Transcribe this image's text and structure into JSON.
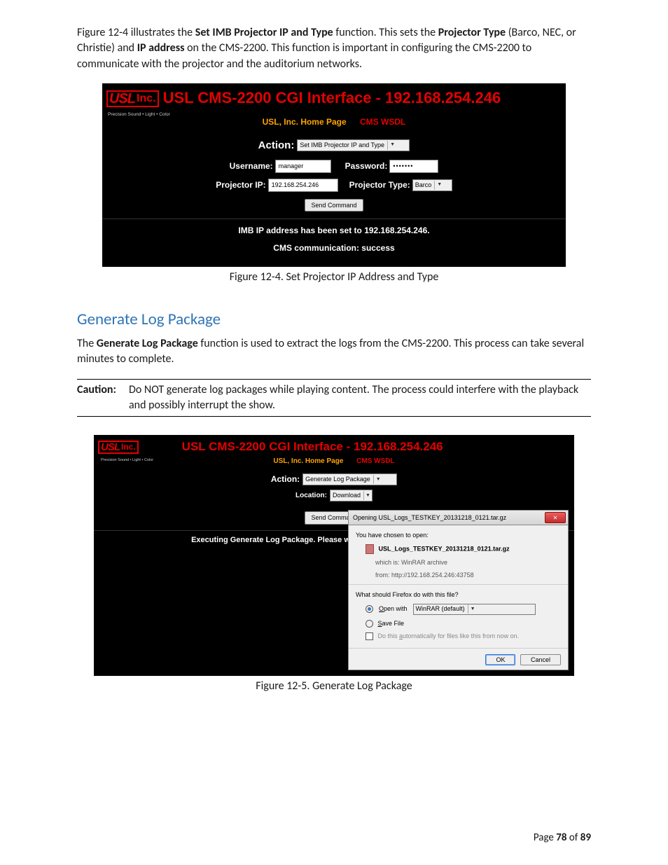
{
  "intro": {
    "pre": "Figure 12-4 illustrates the ",
    "b1": "Set IMB Projector IP and Type",
    "mid1": " function.  This sets the ",
    "b2": "Projector Type",
    "mid2": " (Barco, NEC, or Christie) and ",
    "b3": "IP address",
    "post": " on the CMS-2200.  This function is important in configuring the CMS-2200 to communicate with the projector and the auditorium networks."
  },
  "ss1": {
    "logo_usl": "USL",
    "logo_inc": "Inc.",
    "tagline": "Precision Sound • Light • Color",
    "title": "USL CMS-2200 CGI Interface - 192.168.254.246",
    "link_home": "USL, Inc. Home Page",
    "link_wsdl": "CMS WSDL",
    "action_label": "Action:",
    "action_value": "Set IMB Projector IP and Type",
    "username_label": "Username:",
    "username_value": "manager",
    "password_label": "Password:",
    "password_value": "•••••••",
    "projip_label": "Projector IP:",
    "projip_value": "192.168.254.246",
    "projtype_label": "Projector Type:",
    "projtype_value": "Barco",
    "send": "Send Command",
    "status1": "IMB IP address has been set to 192.168.254.246.",
    "status2": "CMS communication: success"
  },
  "caption1": "Figure 12-4.  Set Projector IP Address and Type",
  "section_heading": "Generate Log Package",
  "gen_para": {
    "pre": "The ",
    "b": "Generate Log Package",
    "post": " function is used to extract the logs from the CMS-2200.  This process can take several minutes to complete."
  },
  "caution": {
    "label": "Caution:",
    "text": "Do NOT generate log packages while playing content.  The process could interfere with the playback and possibly interrupt the show."
  },
  "ss2": {
    "title": "USL CMS-2200 CGI Interface - 192.168.254.246",
    "link_home": "USL, Inc. Home Page",
    "link_wsdl": "CMS WSDL",
    "action_label": "Action:",
    "action_value": "Generate Log Package",
    "location_label": "Location:",
    "location_value": "Download",
    "send": "Send Command",
    "status": "Executing Generate Log Package. Please wait. This may take several minutes.",
    "dialog": {
      "title": "Opening USL_Logs_TESTKEY_20131218_0121.tar.gz",
      "close": "✕",
      "chosen": "You have chosen to open:",
      "filename": "USL_Logs_TESTKEY_20131218_0121.tar.gz",
      "which_is": "which is: WinRAR archive",
      "from": "from: http://192.168.254.246:43758",
      "whatshould": "What should Firefox do with this file?",
      "openwith_u": "O",
      "openwith_rest": "pen with",
      "openwith_value": "WinRAR (default)",
      "save_u": "S",
      "save_rest": "ave File",
      "auto_pre": "Do this ",
      "auto_u": "a",
      "auto_post": "utomatically for files like this from now on.",
      "ok": "OK",
      "cancel": "Cancel"
    }
  },
  "caption2": "Figure 12-5.  Generate Log Package",
  "footer": {
    "pre": "Page ",
    "page": "78",
    "mid": " of ",
    "total": "89"
  }
}
